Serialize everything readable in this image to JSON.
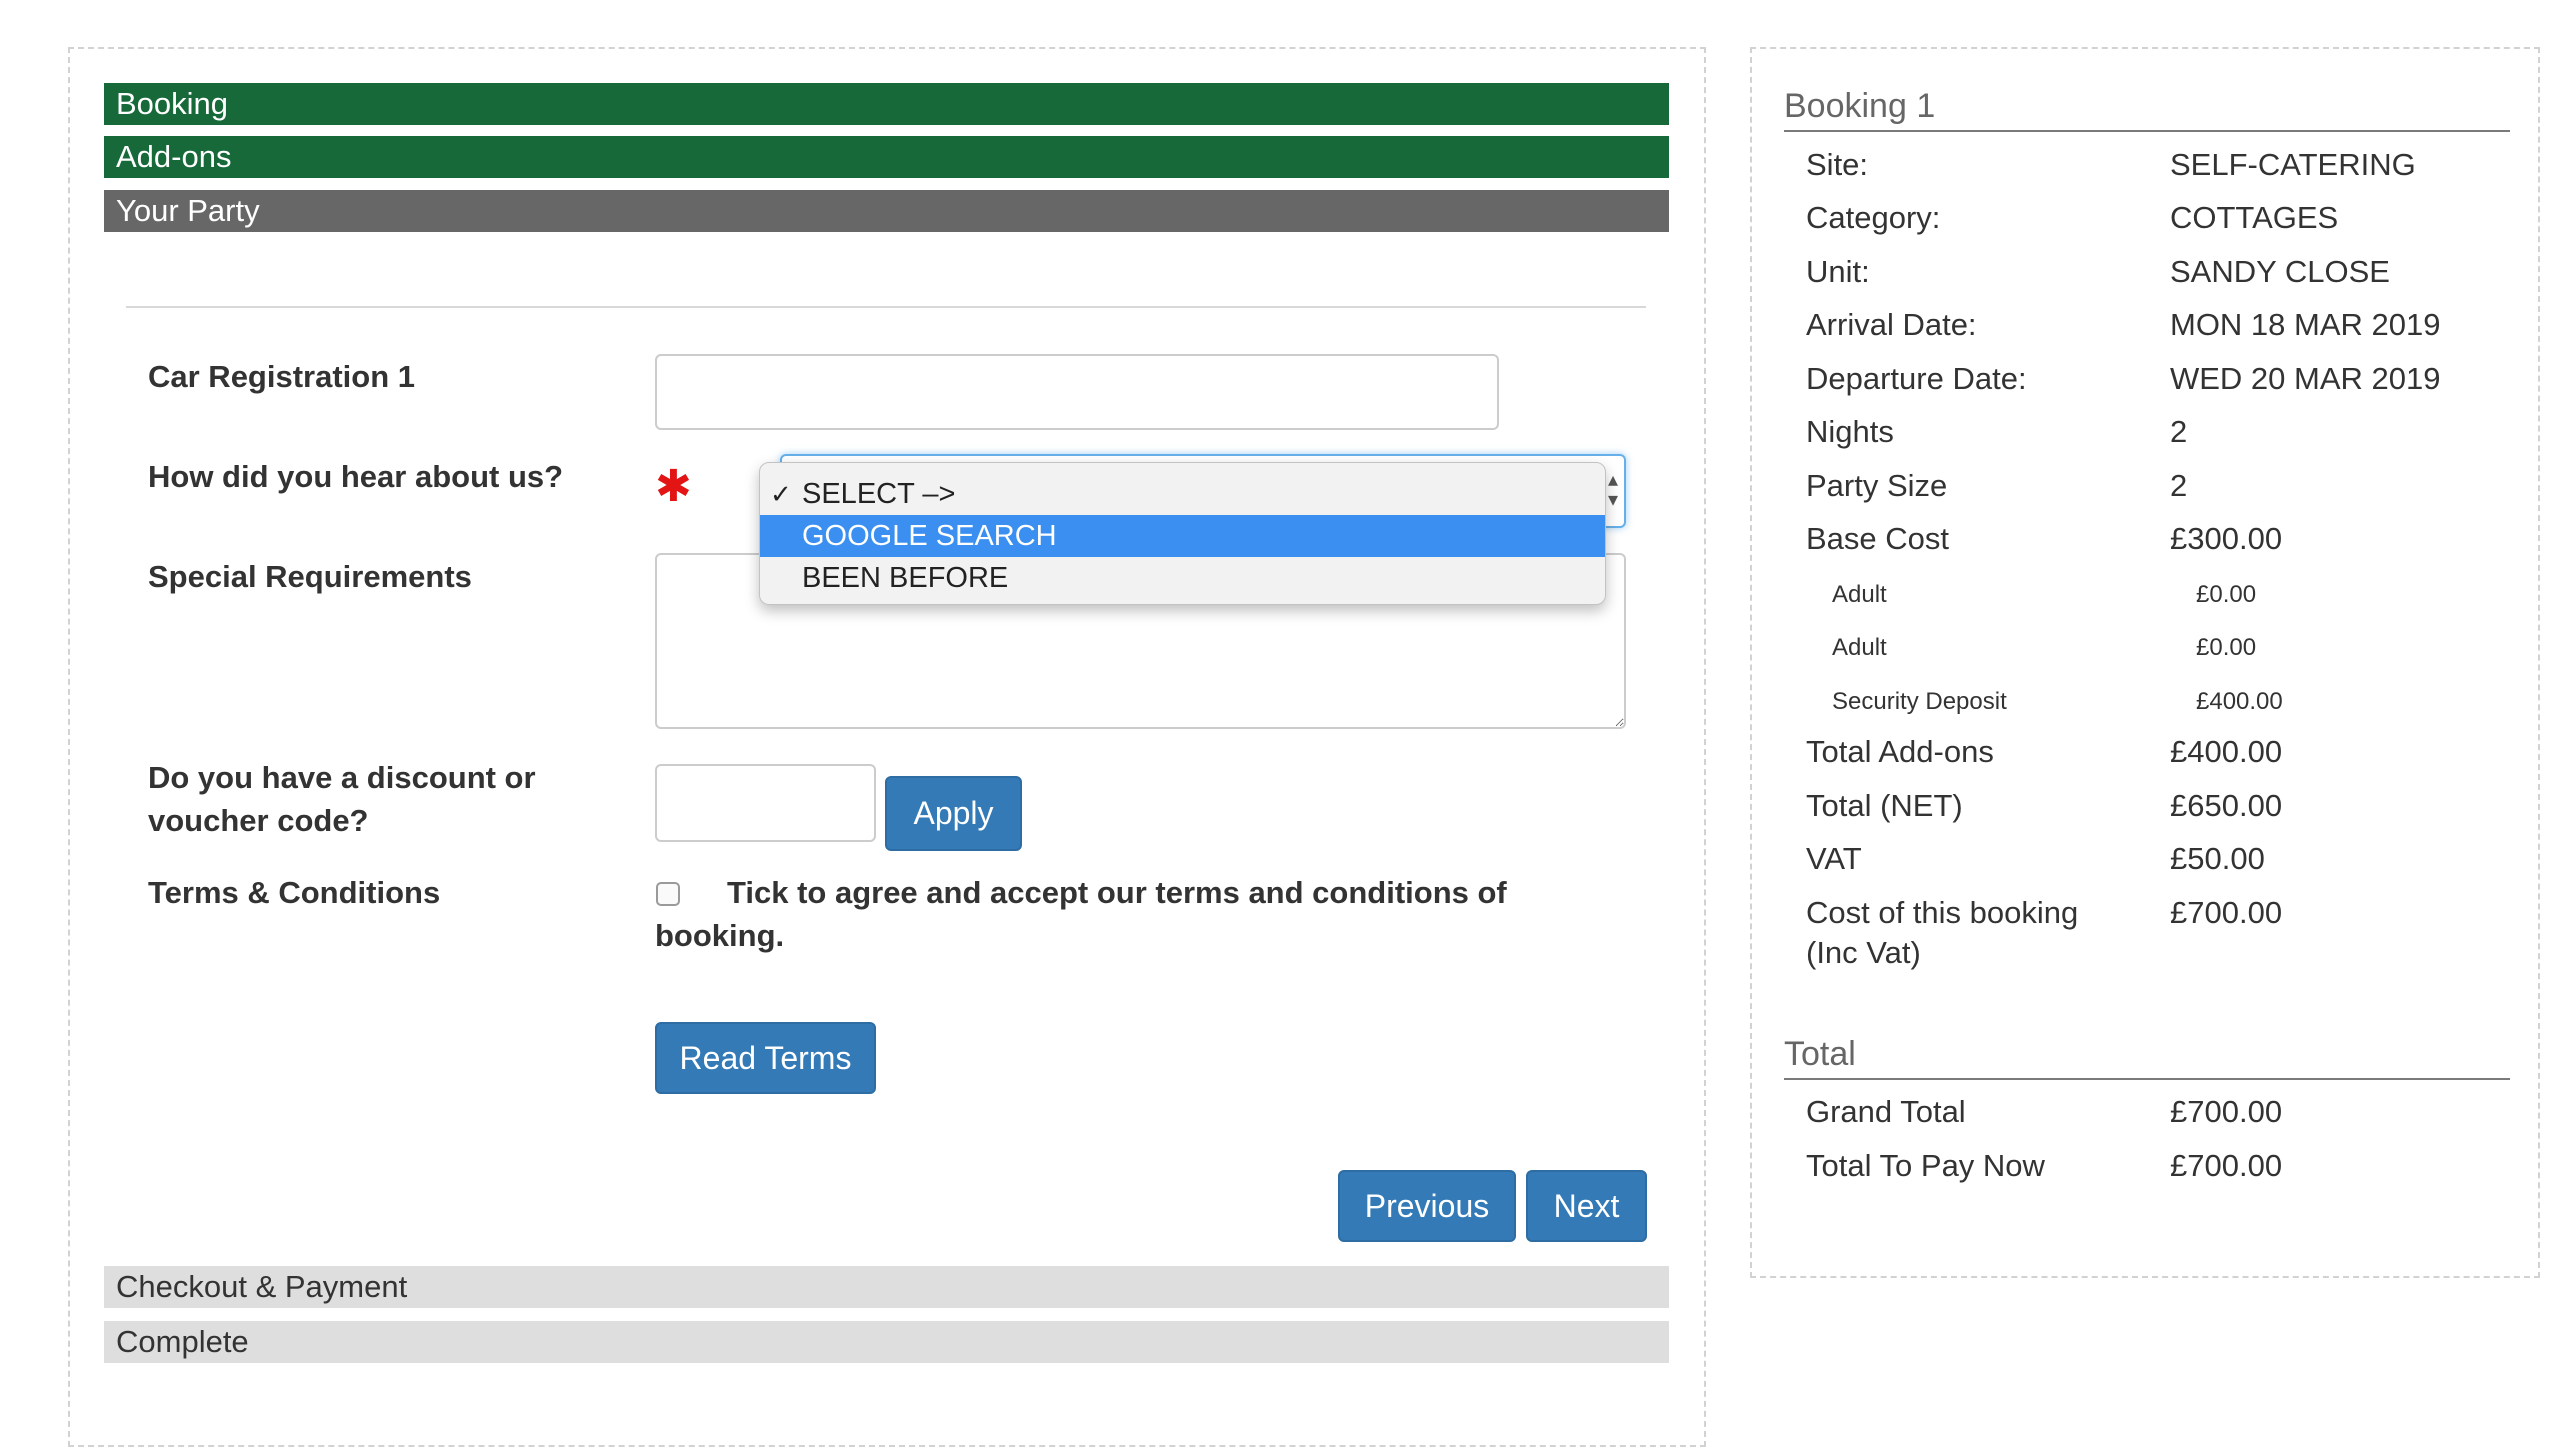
{
  "steps": {
    "booking": "Booking",
    "addons": "Add-ons",
    "your_party": "Your Party",
    "checkout": "Checkout & Payment",
    "complete": "Complete"
  },
  "form": {
    "car_reg_label": "Car Registration 1",
    "car_reg_value": "",
    "hear_label": "How did you hear about us?",
    "required_marker": "✱",
    "hear_options": [
      "SELECT –>",
      "GOOGLE SEARCH",
      "BEEN BEFORE"
    ],
    "hear_checked_option": "SELECT –>",
    "hear_highlighted_option": "GOOGLE SEARCH",
    "special_label": "Special Requirements",
    "special_value": "",
    "discount_label_line1": "Do you have a discount or",
    "discount_label_line2": "voucher code?",
    "discount_value": "",
    "apply_label": "Apply",
    "terms_label": "Terms & Conditions",
    "terms_text": "Tick to agree and accept our terms and conditions of booking.",
    "terms_checked": false,
    "read_terms_label": "Read Terms",
    "previous_label": "Previous",
    "next_label": "Next"
  },
  "summary": {
    "booking_title": "Booking 1",
    "rows": [
      {
        "key": "Site:",
        "value": "SELF-CATERING"
      },
      {
        "key": "Category:",
        "value": "COTTAGES"
      },
      {
        "key": "Unit:",
        "value": "SANDY CLOSE"
      },
      {
        "key": "Arrival Date:",
        "value": "MON 18 MAR 2019"
      },
      {
        "key": "Departure Date:",
        "value": "WED 20 MAR 2019"
      },
      {
        "key": "Nights",
        "value": "2"
      },
      {
        "key": "Party Size",
        "value": "2"
      },
      {
        "key": "Base Cost",
        "value": "£300.00"
      }
    ],
    "sub_rows": [
      {
        "key": "Adult",
        "value": "£0.00"
      },
      {
        "key": "Adult",
        "value": "£0.00"
      },
      {
        "key": "Security Deposit",
        "value": "£400.00"
      }
    ],
    "totals_rows": [
      {
        "key": "Total Add-ons",
        "value": "£400.00"
      },
      {
        "key": "Total (NET)",
        "value": "£650.00"
      },
      {
        "key": "VAT",
        "value": "£50.00"
      }
    ],
    "cost_label_line1": "Cost of this booking",
    "cost_label_line2": "(Inc Vat)",
    "cost_value": "£700.00",
    "total_title": "Total",
    "grand_rows": [
      {
        "key": "Grand Total",
        "value": "£700.00"
      },
      {
        "key": "Total To Pay Now",
        "value": "£700.00"
      }
    ]
  },
  "colors": {
    "step_done": "#17693a",
    "step_active": "#676767",
    "step_pending": "#dedede",
    "button": "#337ab7",
    "required": "#e21414",
    "dropdown_highlight": "#3a8ff0"
  }
}
